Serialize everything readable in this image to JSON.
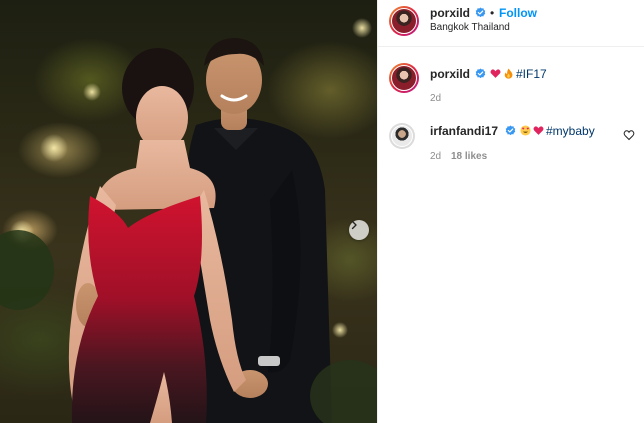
{
  "post": {
    "author": {
      "username": "porxild",
      "verified": true,
      "follow_label": "Follow",
      "separator": "•",
      "location": "Bangkok Thailand"
    },
    "caption": {
      "username": "porxild",
      "emojis": [
        "red-heart",
        "fire"
      ],
      "hashtag": "#IF17",
      "time": "2d"
    },
    "comments": [
      {
        "username": "irfanfandi17",
        "verified": true,
        "emojis": [
          "smiling-face-with-heart-eyes",
          "red-heart"
        ],
        "hashtag": "#mybaby",
        "time": "2d",
        "likes": "18 likes"
      }
    ],
    "media": {
      "carousel_next_icon": "chevron-right-icon"
    }
  },
  "colors": {
    "link_blue": "#0095f6",
    "hashtag": "#00376b",
    "verified_blue": "#3897f0",
    "muted": "#8e8e8e",
    "dress_top": "#c8102e",
    "dress_bottom": "#2a1a1e"
  }
}
